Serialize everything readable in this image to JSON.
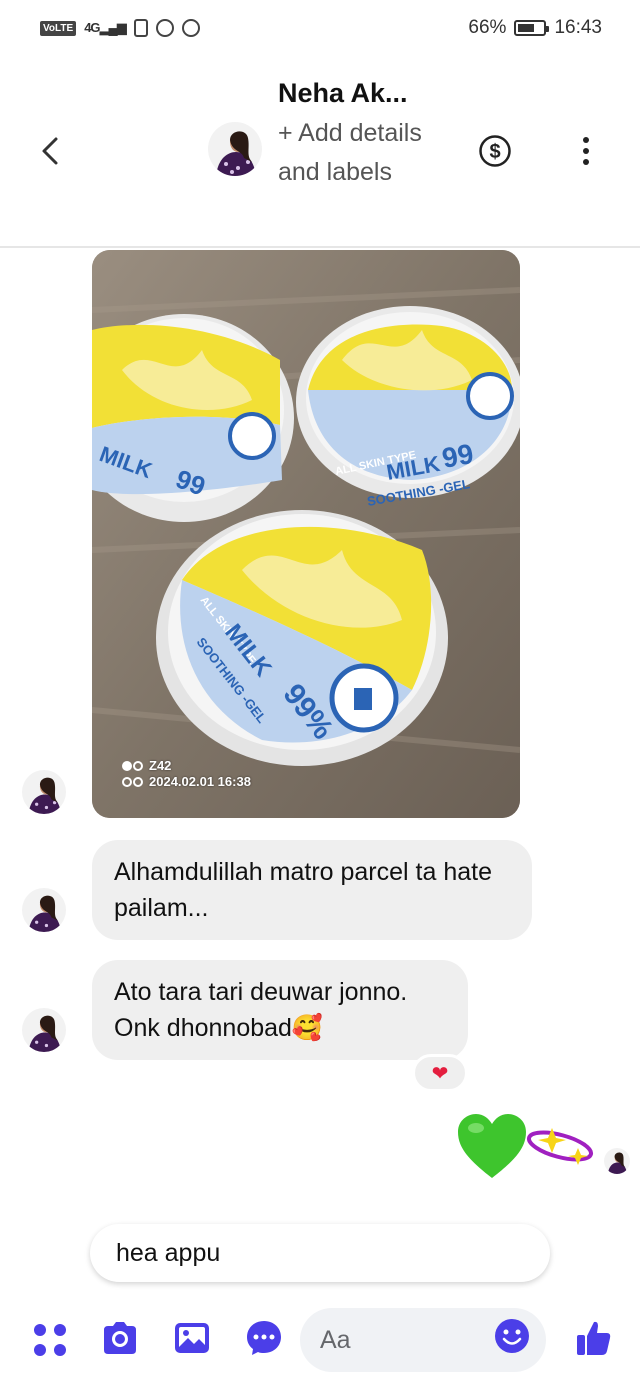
{
  "status_bar": {
    "network_badge": "VoLTE",
    "network_type": "4G",
    "battery": "66%",
    "battery_level": 0.66,
    "time": "16:43"
  },
  "header": {
    "name": "Neha Ak...",
    "subtitle": "+ Add details and labels"
  },
  "photo": {
    "stamp_code": "Z42",
    "stamp_datetime": "2024.02.01 16:38",
    "jar_label_type": "ALL SKIN TYPE",
    "jar_label_name": "MILK",
    "jar_label_product": "SOOTHING -GEL",
    "jar_label_percent": "99%"
  },
  "messages": [
    {
      "text": "Alhamdulillah matro parcel ta hate pailam..."
    },
    {
      "text": "Ato tara tari deuwar jonno. Onk dhonnobad🥰",
      "reaction": "❤"
    }
  ],
  "draft_message": "hea appu",
  "composer": {
    "placeholder": "Aa"
  },
  "colors": {
    "accent": "#4b3ee8",
    "reaction_heart": "#e41e3f",
    "bubble_bg": "#efefef",
    "sticker_heart": "#3ec52d"
  }
}
